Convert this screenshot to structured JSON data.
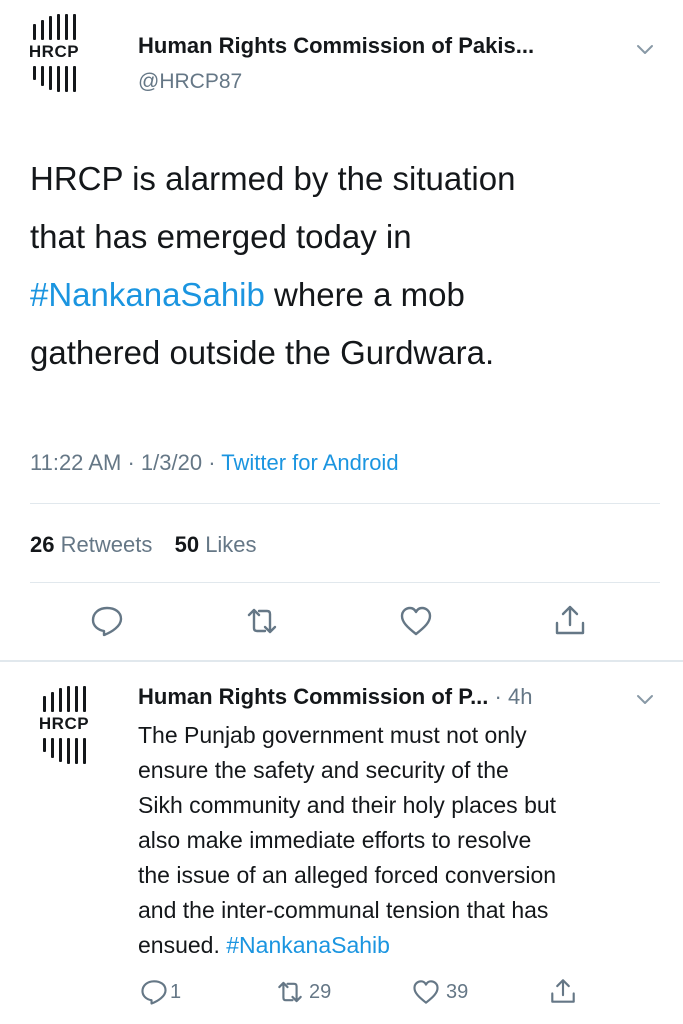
{
  "main_tweet": {
    "display_name": "Human Rights Commission of Pakis...",
    "handle": "@HRCP87",
    "avatar_text": "HRCP",
    "text_lines": [
      {
        "segments": [
          {
            "text": "HRCP is alarmed by the situation",
            "link": false
          }
        ]
      },
      {
        "segments": [
          {
            "text": "that has emerged today in",
            "link": false
          }
        ]
      },
      {
        "segments": [
          {
            "text": "#NankanaSahib",
            "link": true
          },
          {
            "text": " where a mob",
            "link": false
          }
        ]
      },
      {
        "segments": [
          {
            "text": "gathered outside the Gurdwara.",
            "link": false
          }
        ]
      }
    ],
    "time": "11:22 AM",
    "date": "1/3/20",
    "source": "Twitter for Android",
    "retweets_count": "26",
    "retweets_label": "Retweets",
    "likes_count": "50",
    "likes_label": "Likes"
  },
  "reply_tweet": {
    "display_name": "Human Rights Commission of P...",
    "time_ago": "· 4h",
    "avatar_text": "HRCP",
    "text_lines": [
      "The Punjab government must not only",
      "ensure the safety and security of the",
      "Sikh community and their holy places but",
      "also make immediate efforts to resolve",
      "the issue of an alleged forced conversion",
      "and the inter-communal tension that has"
    ],
    "last_line_prefix": "ensued. ",
    "hashtag": "#NankanaSahib",
    "reply_count": "1",
    "retweet_count": "29",
    "like_count": "39"
  },
  "colors": {
    "link": "#1b95e0",
    "muted": "#657786",
    "text": "#14171a",
    "divider": "#e1e8ed"
  },
  "icons": [
    "reply-icon",
    "retweet-icon",
    "like-icon",
    "share-icon",
    "chevron-down-icon"
  ]
}
